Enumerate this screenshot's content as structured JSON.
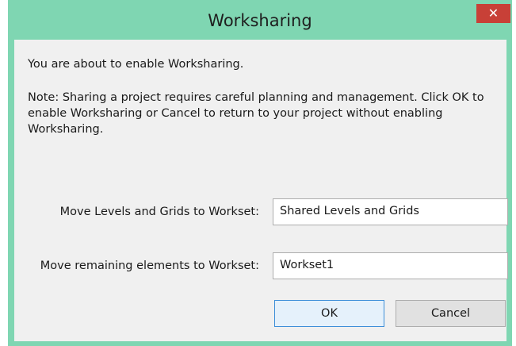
{
  "window": {
    "title": "Worksharing",
    "close_glyph": "✕",
    "titlebar_color": "#7fd6b2",
    "close_color": "#c84037"
  },
  "dialog": {
    "intro": "You are about to enable Worksharing.",
    "note": "Note: Sharing a project requires careful planning and management.  Click OK to enable Worksharing or Cancel to return to your project without enabling Worksharing.",
    "levels_label": "Move Levels and Grids to Workset:",
    "levels_value": "Shared Levels and Grids",
    "remaining_label": "Move remaining elements to Workset:",
    "remaining_value": "Workset1",
    "ok_label": "OK",
    "cancel_label": "Cancel"
  }
}
